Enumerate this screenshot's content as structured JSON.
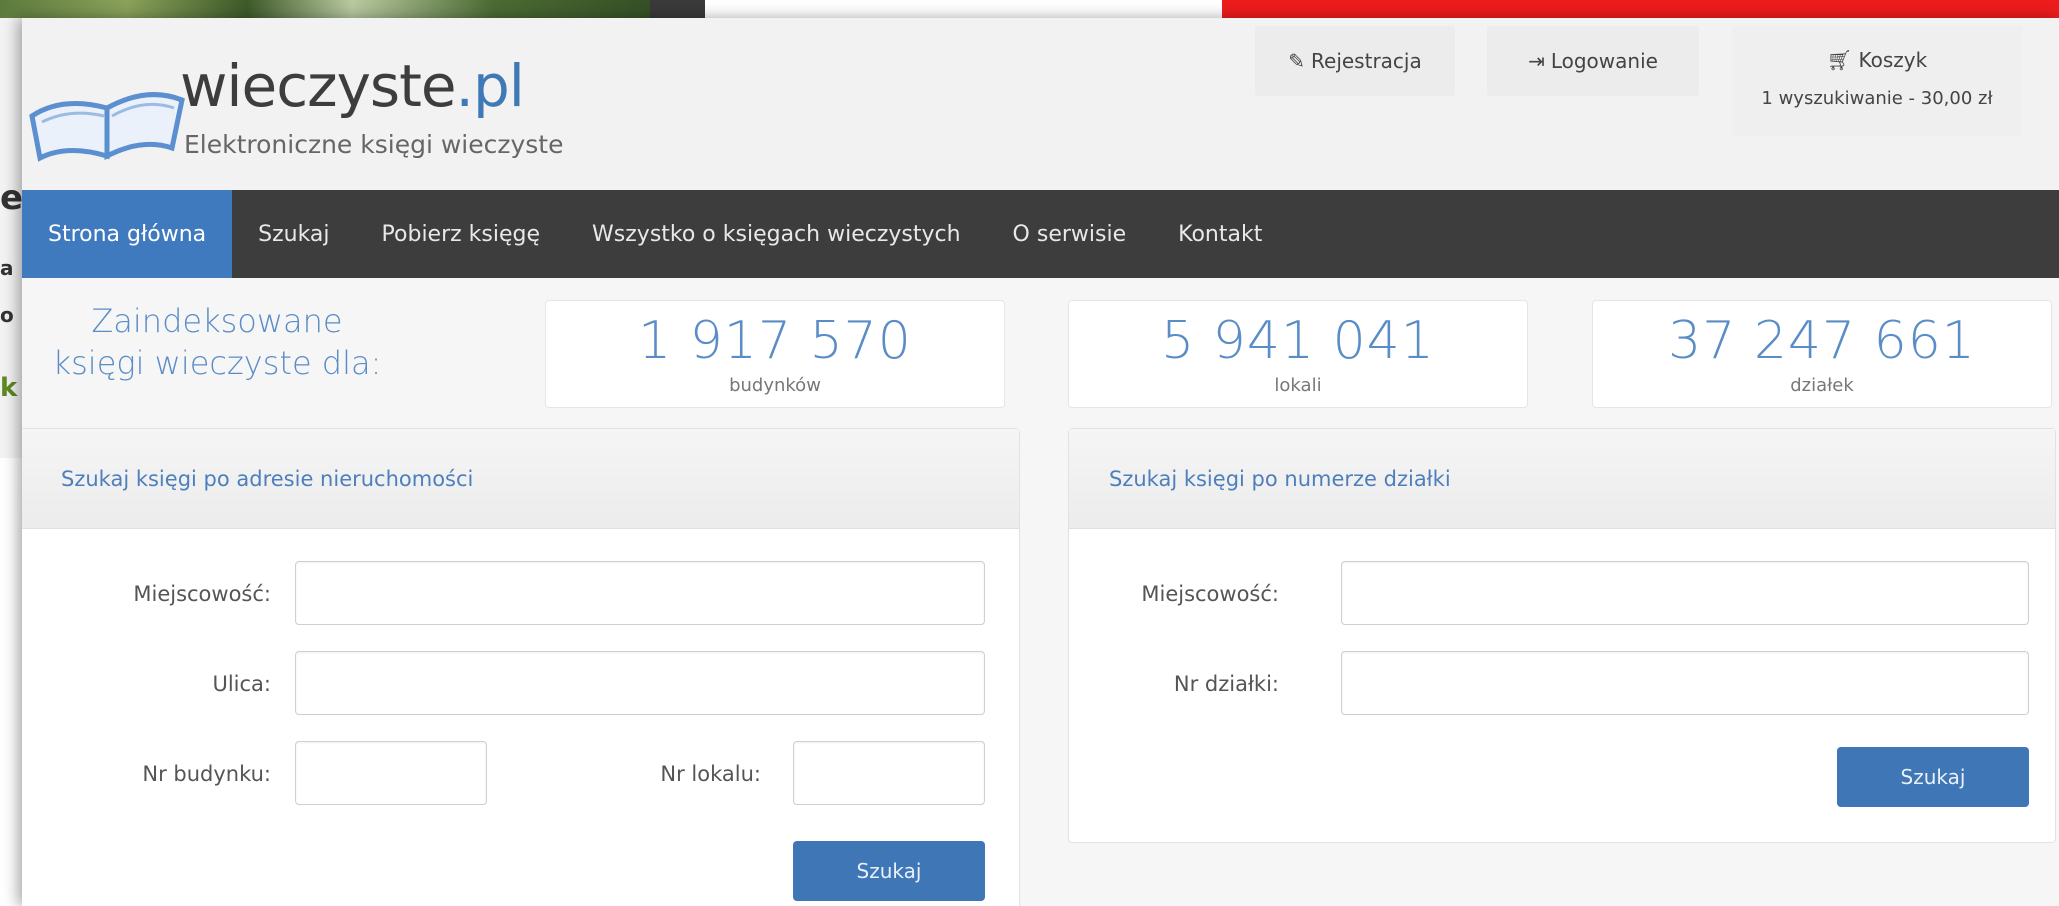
{
  "site": {
    "name_main": "wieczyste",
    "name_tld": ".pl",
    "tagline": "Elektroniczne księgi wieczyste"
  },
  "header": {
    "register_label": "Rejestracja",
    "login_label": "Logowanie",
    "cart_title": "Koszyk",
    "cart_summary": "1 wyszukiwanie - 30,00 zł"
  },
  "nav": {
    "items": [
      {
        "label": "Strona główna"
      },
      {
        "label": "Szukaj"
      },
      {
        "label": "Pobierz księgę"
      },
      {
        "label": "Wszystko o księgach wieczystych"
      },
      {
        "label": "O serwisie"
      },
      {
        "label": "Kontakt"
      }
    ]
  },
  "stats": {
    "label": "Zaindeksowane księgi wieczyste dla:",
    "items": [
      {
        "value": "1 917 570",
        "caption": "budynków"
      },
      {
        "value": "5 941 041",
        "caption": "lokali"
      },
      {
        "value": "37 247 661",
        "caption": "działek"
      }
    ]
  },
  "address_search": {
    "title": "Szukaj księgi po adresie nieruchomości",
    "city_label": "Miejscowość:",
    "city_value": "",
    "street_label": "Ulica:",
    "street_value": "",
    "building_label": "Nr budynku:",
    "building_value": "",
    "unit_label": "Nr lokalu:",
    "unit_value": "",
    "button_label": "Szukaj"
  },
  "plot_search": {
    "title": "Szukaj księgi po numerze działki",
    "city_label": "Miejscowość:",
    "city_value": "",
    "plot_label": "Nr działki:",
    "plot_value": "",
    "button_label": "Szukaj"
  },
  "background_fragments": [
    "e",
    "a",
    "o",
    "k"
  ],
  "colors": {
    "accent": "#3f7abf",
    "nav_bg": "#3d3d3d",
    "stat_text": "#5a8cc6",
    "red_bar": "#ee1c1c"
  }
}
